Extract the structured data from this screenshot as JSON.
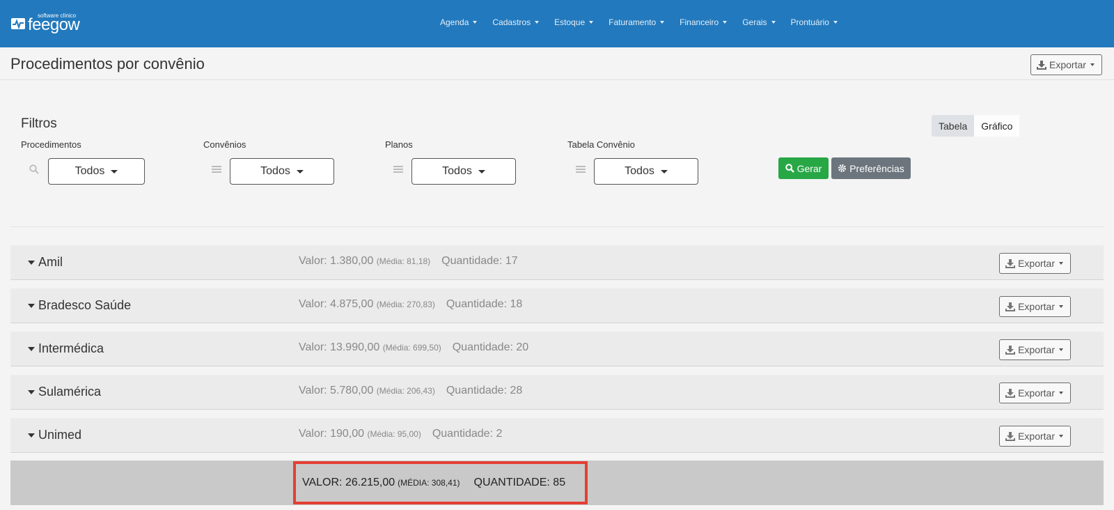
{
  "app": {
    "logo_tag": "software clínico",
    "logo_brand": "feegow"
  },
  "nav": {
    "items": [
      "Agenda",
      "Cadastros",
      "Estoque",
      "Faturamento",
      "Financeiro",
      "Gerais",
      "Prontuário"
    ]
  },
  "page": {
    "title": "Procedimentos por convênio",
    "export_label": "Exportar"
  },
  "filters": {
    "title": "Filtros",
    "procedimentos": {
      "label": "Procedimentos",
      "value": "Todos",
      "icon": "search-icon"
    },
    "convenios": {
      "label": "Convênios",
      "value": "Todos",
      "icon": "list-icon"
    },
    "planos": {
      "label": "Planos",
      "value": "Todos",
      "icon": "list-icon"
    },
    "tabela": {
      "label": "Tabela Convênio",
      "value": "Todos",
      "icon": "list-icon"
    },
    "gerar_label": "Gerar",
    "preferencias_label": "Preferências"
  },
  "view_toggle": {
    "tabela": "Tabela",
    "grafico": "Gráfico",
    "active": "Tabela"
  },
  "rows": [
    {
      "name": "Amil",
      "valor": "Valor: 1.380,00",
      "media": "(Média: 81,18)",
      "quantidade": "Quantidade: 17",
      "export": "Exportar"
    },
    {
      "name": "Bradesco Saúde",
      "valor": "Valor: 4.875,00",
      "media": "(Média: 270,83)",
      "quantidade": "Quantidade: 18",
      "export": "Exportar"
    },
    {
      "name": "Intermédica",
      "valor": "Valor: 13.990,00",
      "media": "(Média: 699,50)",
      "quantidade": "Quantidade: 20",
      "export": "Exportar"
    },
    {
      "name": "Sulamérica",
      "valor": "Valor: 5.780,00",
      "media": "(Média: 206,43)",
      "quantidade": "Quantidade: 28",
      "export": "Exportar"
    },
    {
      "name": "Unimed",
      "valor": "Valor: 190,00",
      "media": "(Média: 95,00)",
      "quantidade": "Quantidade: 2",
      "export": "Exportar"
    }
  ],
  "total": {
    "valor": "VALOR: 26.215,00",
    "media": "(MÉDIA: 308,41)",
    "quantidade": "QUANTIDADE: 85"
  },
  "colors": {
    "navbar": "#2279bd",
    "gerar": "#28a745",
    "preferencias": "#6c757d",
    "highlight": "#e43f33"
  }
}
